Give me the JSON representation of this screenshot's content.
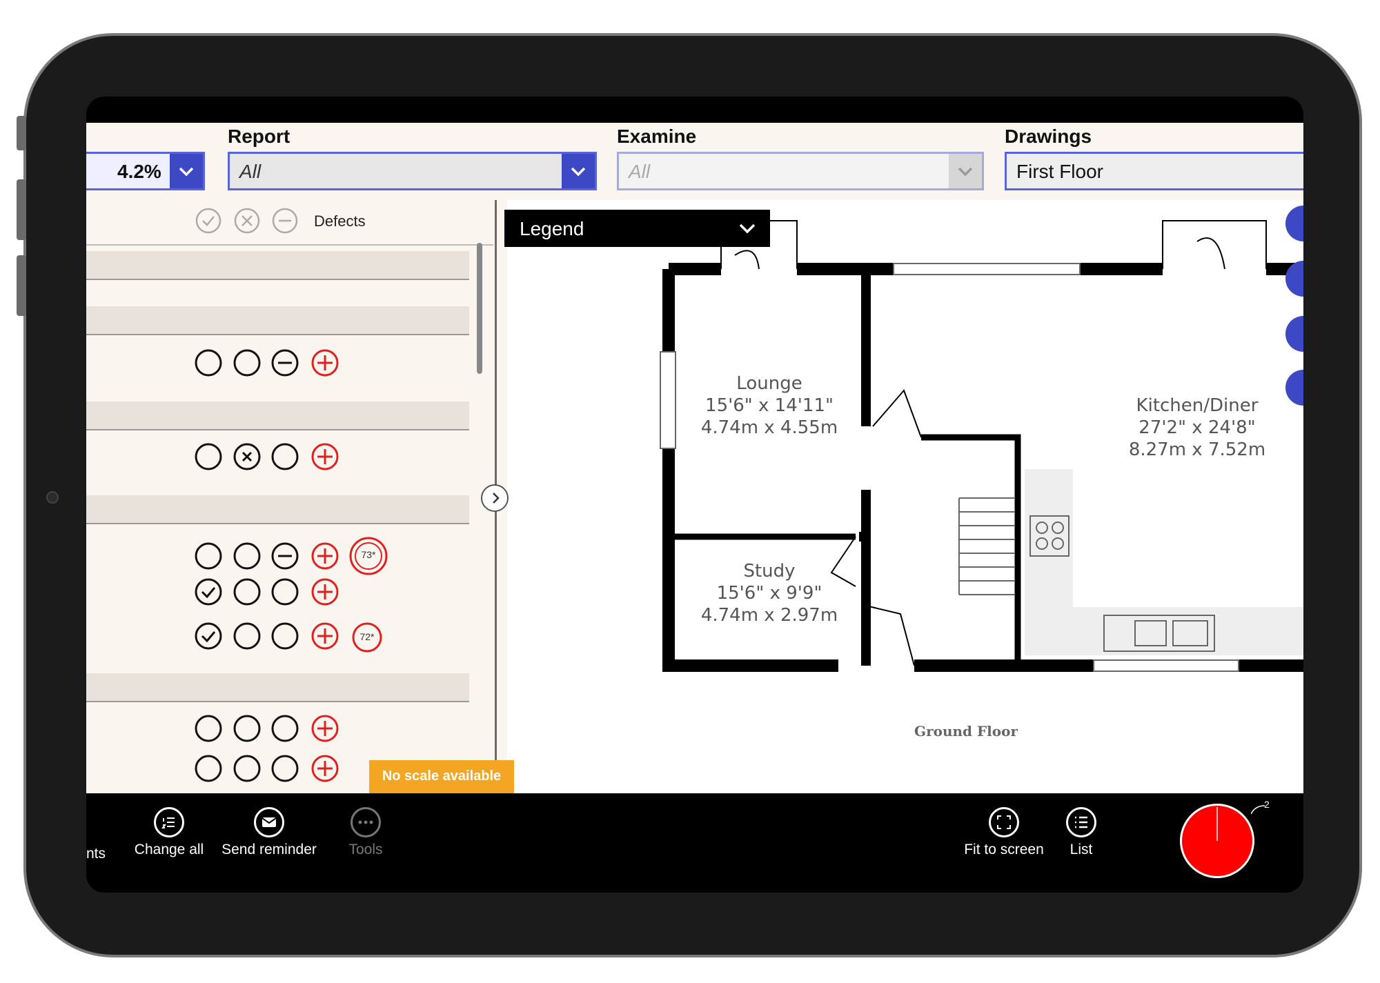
{
  "toolbar": {
    "zoom_value": "4.2%",
    "report_label": "Report",
    "report_value": "All",
    "examine_label": "Examine",
    "examine_value": "All",
    "drawings_label": "Drawings",
    "drawings_value": "First Floor"
  },
  "checklist": {
    "header_defects": "Defects",
    "badges": [
      "73*",
      "72*"
    ]
  },
  "drawing": {
    "legend_label": "Legend",
    "rooms": [
      {
        "name": "Lounge",
        "imperial": "15'6\" x 14'11\"",
        "metric": "4.74m x 4.55m"
      },
      {
        "name": "Kitchen/Diner",
        "imperial": "27'2\" x 24'8\"",
        "metric": "8.27m x 7.52m"
      },
      {
        "name": "Study",
        "imperial": "15'6\" x 9'9\"",
        "metric": "4.74m x 2.97m"
      }
    ],
    "floor_label": "Ground Floor"
  },
  "notice": {
    "text": "No scale available"
  },
  "bottom": {
    "partial_label": "nts",
    "buttons": [
      {
        "label": "Change all"
      },
      {
        "label": "Send reminder"
      },
      {
        "label": "Tools"
      },
      {
        "label": "Fit to screen"
      },
      {
        "label": "List"
      }
    ],
    "pie_count": "2"
  },
  "colors": {
    "accent": "#3d48c4",
    "alert": "#ff0000",
    "notice": "#f4a521"
  }
}
